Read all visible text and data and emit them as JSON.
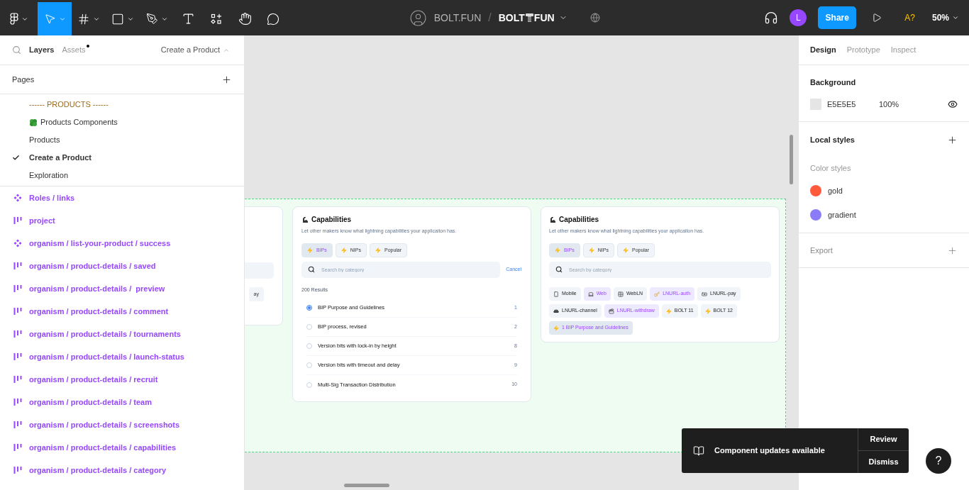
{
  "toolbar": {
    "tools": [
      {
        "kind": "logo",
        "selected": false,
        "has_menu": true
      },
      {
        "kind": "move",
        "selected": true,
        "has_menu": true
      },
      {
        "kind": "frame",
        "selected": false,
        "has_menu": true
      },
      {
        "kind": "shape",
        "selected": false,
        "has_menu": true
      },
      {
        "kind": "pen",
        "selected": false,
        "has_menu": true
      },
      {
        "kind": "text",
        "selected": false,
        "has_menu": false
      },
      {
        "kind": "resources",
        "selected": false,
        "has_menu": false
      },
      {
        "kind": "hand",
        "selected": false,
        "has_menu": false
      },
      {
        "kind": "comment",
        "selected": false,
        "has_menu": false
      }
    ],
    "project": "BOLT.FUN",
    "separator": "/",
    "file_name_parts": [
      "BOLT",
      "FUN"
    ],
    "user_initial": "L",
    "share": "Share",
    "font_warning": "A?",
    "zoom": "50%"
  },
  "left_panel": {
    "tabs": [
      {
        "label": "Layers",
        "selected": true,
        "badge": false
      },
      {
        "label": "Assets",
        "selected": false,
        "badge": true
      }
    ],
    "current_page": "Create a Product",
    "pages_title": "Pages",
    "pages": [
      {
        "label": "------ PRODUCTS ------",
        "kind": "header",
        "selected": false
      },
      {
        "label": "Products Components",
        "kind": "icon",
        "selected": false
      },
      {
        "label": "Products",
        "kind": "plain",
        "selected": false
      },
      {
        "label": "Create a Product",
        "kind": "plain",
        "selected": true
      },
      {
        "label": "Exploration",
        "kind": "plain",
        "selected": false
      }
    ],
    "layers": [
      {
        "name": "Roles / links",
        "kind": "component"
      },
      {
        "name": "project",
        "kind": "frame"
      },
      {
        "name": "organism / list-your-product / success",
        "kind": "component"
      },
      {
        "name": "organism / product-details / saved",
        "kind": "frame"
      },
      {
        "name": "organism / product-details /  preview",
        "kind": "frame"
      },
      {
        "name": "organism / product-details / comment",
        "kind": "frame"
      },
      {
        "name": "organism / product-details / tournaments",
        "kind": "frame"
      },
      {
        "name": "organism / product-details / launch-status",
        "kind": "frame"
      },
      {
        "name": "organism / product-details / recruit",
        "kind": "frame"
      },
      {
        "name": "organism / product-details / team",
        "kind": "frame"
      },
      {
        "name": "organism / product-details / screenshots",
        "kind": "frame"
      },
      {
        "name": "organism / product-details / capabilities",
        "kind": "frame"
      },
      {
        "name": "organism / product-details / category",
        "kind": "frame"
      }
    ]
  },
  "canvas": {
    "partial_card": {
      "chip": "ay"
    },
    "list_card": {
      "title": "Capabilities",
      "description": "Let other makers know what lightning capabilities your applicaiton has.",
      "filters": [
        {
          "label": "BIPs",
          "selected": true
        },
        {
          "label": "NIPs",
          "selected": false
        },
        {
          "label": "Popular",
          "selected": false
        }
      ],
      "search_placeholder": "Search by category",
      "cancel": "Cancel",
      "results": "200 Results",
      "rows": [
        {
          "label": "BIP Purpose and Guidelines",
          "number": "1",
          "selected": true
        },
        {
          "label": "BIP process, revised",
          "number": "2",
          "selected": false
        },
        {
          "label": "Version bits with lock-in by height",
          "number": "8",
          "selected": false
        },
        {
          "label": "Version bits with timeout and delay",
          "number": "9",
          "selected": false
        },
        {
          "label": "Multi-Sig Transaction Distribution",
          "number": "10",
          "selected": false
        }
      ]
    },
    "tags_card": {
      "title": "Capabilities",
      "description": "Let other makers know what lightning capabilities your applicaiton has.",
      "filters": [
        {
          "label": "BIPs",
          "selected": true
        },
        {
          "label": "NIPs",
          "selected": false
        },
        {
          "label": "Popular",
          "selected": false
        }
      ],
      "search_placeholder": "Search by category",
      "tags": [
        {
          "label": "Mobile",
          "kind": "tag",
          "selected": false
        },
        {
          "label": "Web",
          "kind": "tag",
          "selected": true
        },
        {
          "label": "WebLN",
          "kind": "tag",
          "selected": false
        },
        {
          "label": "LNURL-auth",
          "kind": "tag",
          "selected": true
        },
        {
          "label": "LNURL-pay",
          "kind": "tag",
          "selected": false
        },
        {
          "label": "LNURL-channel",
          "kind": "tag",
          "selected": false
        },
        {
          "label": "LNURL-withdraw",
          "kind": "tag",
          "selected": true
        },
        {
          "label": "BOLT 11",
          "kind": "tag",
          "selected": false
        },
        {
          "label": "BOLT 12",
          "kind": "tag",
          "selected": false
        },
        {
          "label": "1 BIP Purpose and Guidelines",
          "kind": "chosen",
          "selected": true
        }
      ]
    }
  },
  "right_panel": {
    "tabs": [
      {
        "label": "Design",
        "selected": true
      },
      {
        "label": "Prototype",
        "selected": false
      },
      {
        "label": "Inspect",
        "selected": false
      }
    ],
    "background": {
      "title": "Background",
      "hex": "E5E5E5",
      "opacity": "100%",
      "visible": true
    },
    "local_styles": {
      "title": "Local styles",
      "subtitle": "Color styles",
      "styles": [
        {
          "name": "gold",
          "color": "#ff5a3c"
        },
        {
          "name": "gradient",
          "color": "#8a7cf6"
        }
      ]
    },
    "export": {
      "title": "Export"
    }
  },
  "toast": {
    "message": "Component updates available",
    "actions": [
      "Review",
      "Dismiss"
    ]
  },
  "help": "?"
}
